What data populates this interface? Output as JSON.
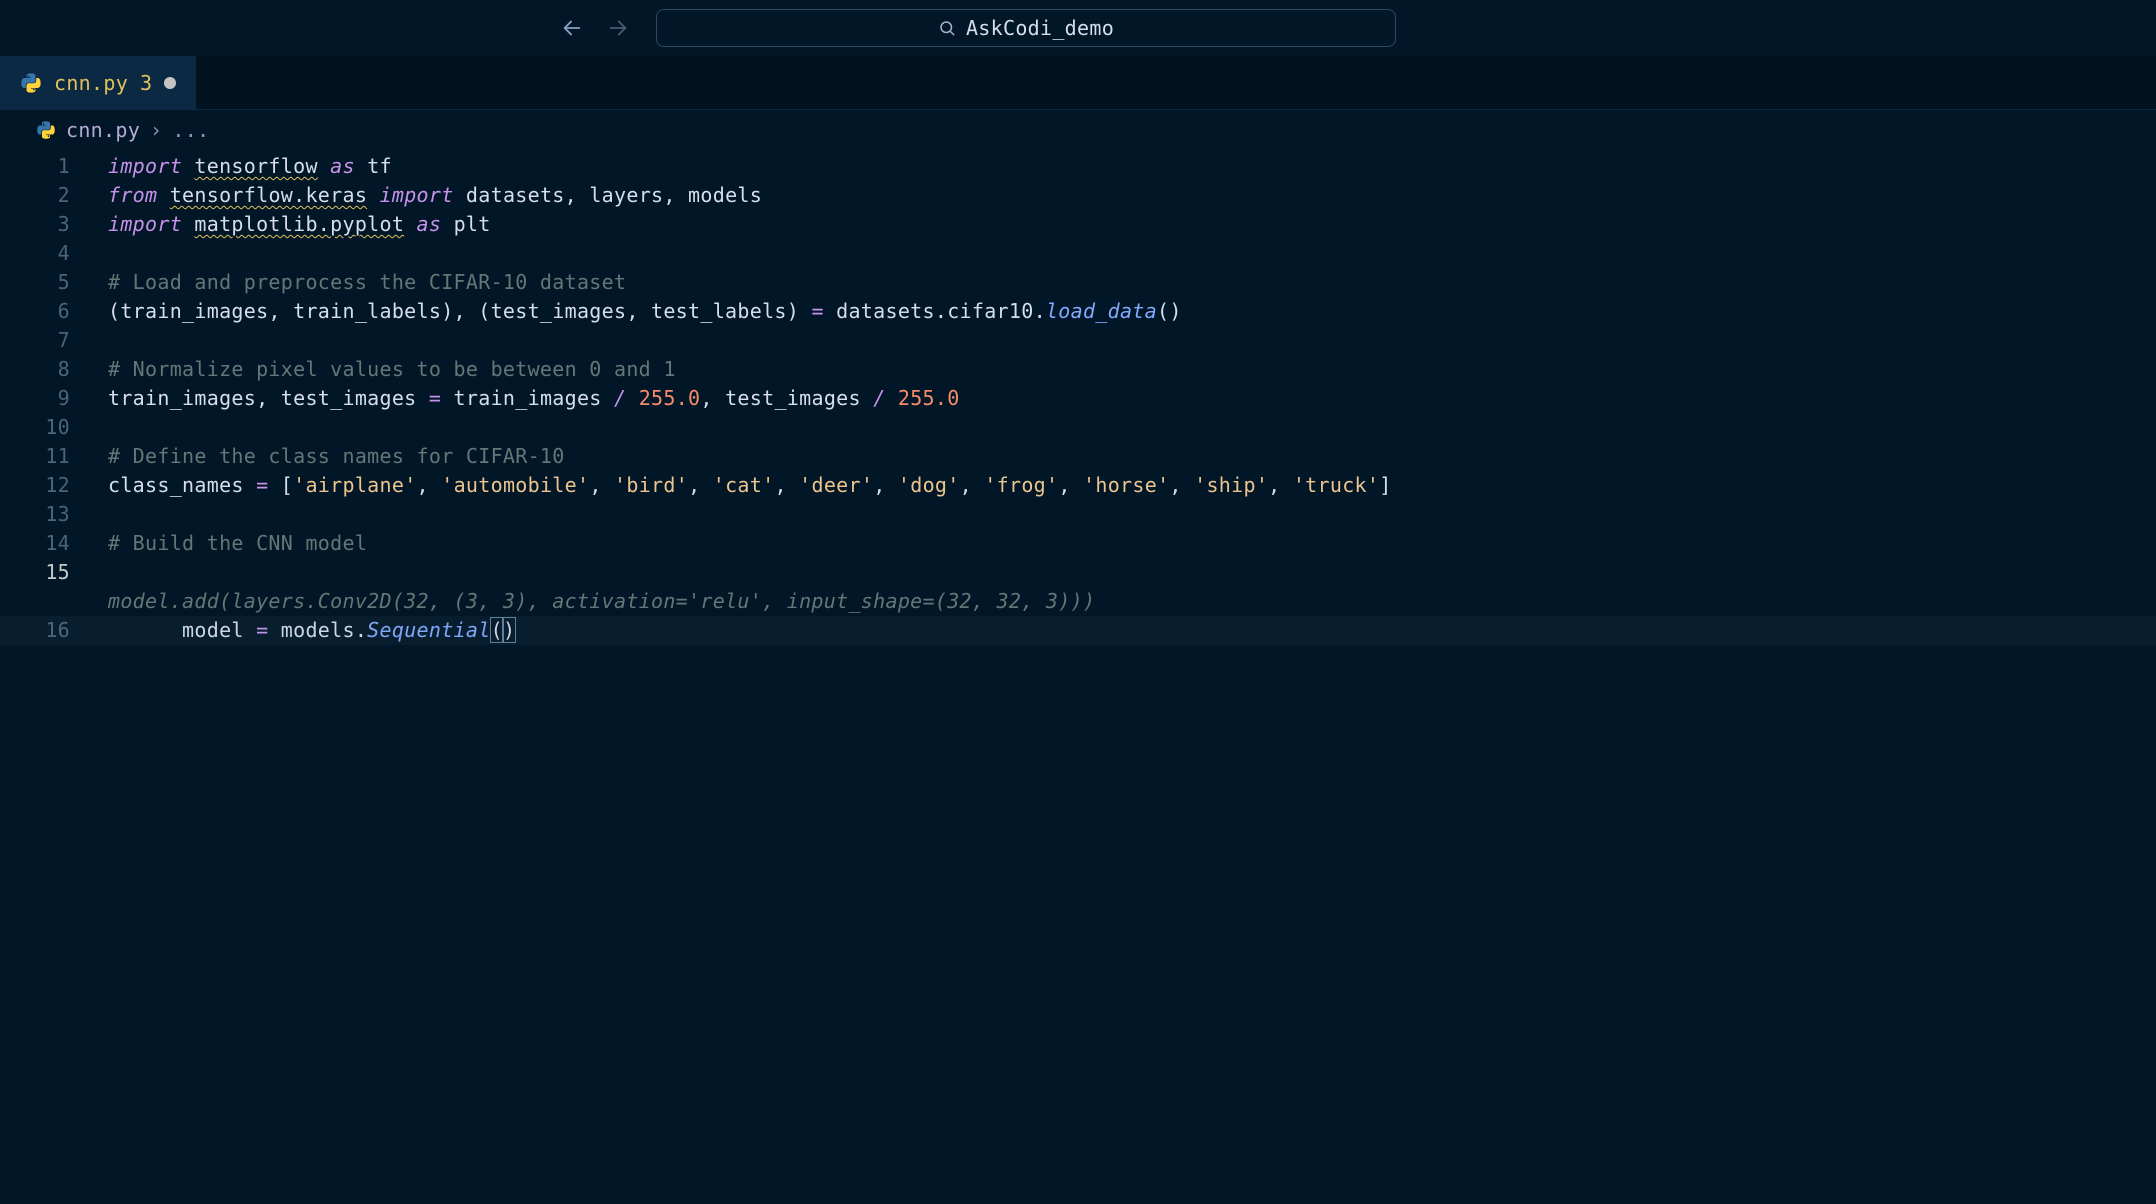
{
  "titlebar": {
    "search_label": "AskCodi_demo"
  },
  "tab": {
    "filename": "cnn.py",
    "problem_count": "3"
  },
  "breadcrumb": {
    "filename": "cnn.py",
    "separator": "›",
    "rest": "..."
  },
  "gutter": {
    "lines": [
      "1",
      "2",
      "3",
      "4",
      "5",
      "6",
      "7",
      "8",
      "9",
      "10",
      "11",
      "12",
      "13",
      "14",
      "15",
      "",
      "16"
    ],
    "current_index": 14
  },
  "code": {
    "l1": {
      "kw1": "import",
      "mod": "tensorflow",
      "kw2": "as",
      "alias": "tf"
    },
    "l2": {
      "kw1": "from",
      "mod": "tensorflow.keras",
      "kw2": "import",
      "names": "datasets, layers, models"
    },
    "l3": {
      "kw1": "import",
      "mod": "matplotlib.pyplot",
      "kw2": "as",
      "alias": "plt"
    },
    "l5": "# Load and preprocess the CIFAR-10 dataset",
    "l6_a": "(train_images, train_labels), (test_images, test_labels) ",
    "l6_eq": "=",
    "l6_b": " datasets.cifar10.",
    "l6_fn": "load_data",
    "l6_c": "()",
    "l8": "# Normalize pixel values to be between 0 and 1",
    "l9_a": "train_images, test_images ",
    "l9_eq": "=",
    "l9_b": " train_images ",
    "l9_op1": "/",
    "l9_sp1": " ",
    "l9_n1": "255.0",
    "l9_c": ", test_images ",
    "l9_op2": "/",
    "l9_sp2": " ",
    "l9_n2": "255.0",
    "l11": "# Define the class names for CIFAR-10",
    "l12_a": "class_names ",
    "l12_eq": "=",
    "l12_b": " [",
    "l12_strings": [
      "'airplane'",
      "'automobile'",
      "'bird'",
      "'cat'",
      "'deer'",
      "'dog'",
      "'frog'",
      "'horse'",
      "'ship'",
      "'truck'"
    ],
    "l12_c": "]",
    "l14": "# Build the CNN model",
    "l15_a": "model ",
    "l15_eq": "=",
    "l15_b": " models.",
    "l15_fn": "Sequential",
    "l15_p1": "(",
    "l15_p2": ")",
    "ghost": "model.add(layers.Conv2D(32, (3, 3), activation='relu', input_shape=(32, 32, 3)))"
  }
}
